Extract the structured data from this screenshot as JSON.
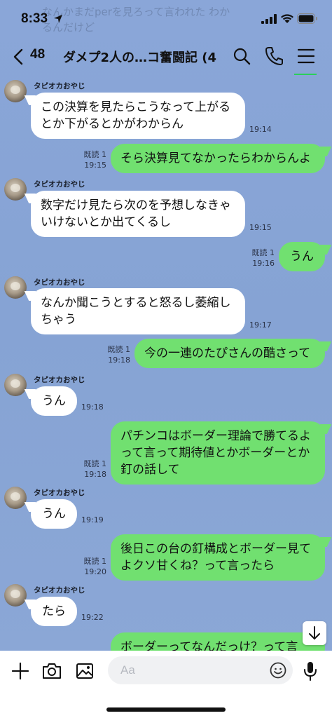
{
  "status_bar": {
    "time": "8:33"
  },
  "notification_ghost": {
    "text": "なんかまだperを見ろって言われた わかるんだけど"
  },
  "header": {
    "back_count": "48",
    "title": "ダメプ2人の…コ奮闘記 (4)"
  },
  "colors": {
    "chat_bg": "#8aa6d6",
    "outgoing": "#71e070",
    "incoming": "#ffffff",
    "accent": "#2bcf5a"
  },
  "messages": [
    {
      "dir": "in",
      "sender": "タピオカおやじ",
      "text": "この決算を見たらこうなって上がるとか下がるとかがわからん",
      "time": "19:14"
    },
    {
      "dir": "out",
      "read": "既読 1",
      "text": "そら決算見てなかったらわからんよ",
      "time": "19:15"
    },
    {
      "dir": "in",
      "sender": "タピオカおやじ",
      "text": "数字だけ見たら次のを予想しなきゃいけないとか出てくるし",
      "time": "19:15"
    },
    {
      "dir": "out",
      "read": "既読 1",
      "text": "うん",
      "time": "19:16"
    },
    {
      "dir": "in",
      "sender": "タピオカおやじ",
      "text": "なんか聞こうとすると怒るし萎縮しちゃう",
      "time": "19:17"
    },
    {
      "dir": "out",
      "read": "既読 1",
      "text": "今の一連のたぴさんの酷さって",
      "time": "19:18"
    },
    {
      "dir": "in",
      "sender": "タピオカおやじ",
      "text": "うん",
      "time": "19:18"
    },
    {
      "dir": "out",
      "read": "既読 1",
      "text": "パチンコはボーダー理論で勝てるよって言って期待値とかボーダーとか釘の話して",
      "time": "19:18"
    },
    {
      "dir": "in",
      "sender": "タピオカおやじ",
      "text": "うん",
      "time": "19:19"
    },
    {
      "dir": "out",
      "read": "既読 1",
      "text": "後日この台の釘構成とボーダー見てよクソ甘くね？って言ったら",
      "time": "19:20"
    },
    {
      "dir": "in",
      "sender": "タピオカおやじ",
      "text": "たら",
      "time": "19:22"
    },
    {
      "dir": "out",
      "read": "",
      "text": "ボーダーってなんだっけ？って言",
      "time": ""
    }
  ],
  "input": {
    "placeholder": "Aa"
  }
}
